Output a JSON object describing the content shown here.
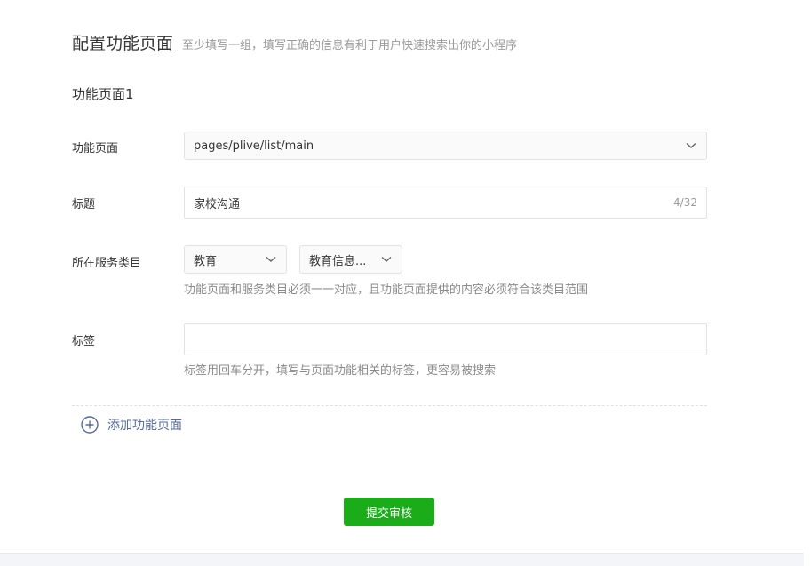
{
  "header": {
    "title": "配置功能页面",
    "subtitle": "至少填写一组，填写正确的信息有利于用户快速搜索出你的小程序"
  },
  "section": {
    "title": "功能页面1"
  },
  "form": {
    "page": {
      "label": "功能页面",
      "value": "pages/plive/list/main"
    },
    "title": {
      "label": "标题",
      "value": "家校沟通",
      "counter": "4/32"
    },
    "category": {
      "label": "所在服务类目",
      "primary": "教育",
      "secondary": "教育信息...",
      "hint": "功能页面和服务类目必须一一对应，且功能页面提供的内容必须符合该类目范围"
    },
    "tags": {
      "label": "标签",
      "value": "",
      "hint": "标签用回车分开，填写与页面功能相关的标签，更容易被搜索"
    }
  },
  "add_page": {
    "label": "添加功能页面",
    "icon": "plus-circle-icon"
  },
  "submit": {
    "label": "提交审核"
  },
  "colors": {
    "primary_green": "#1aad19",
    "link_blue": "#576b95"
  }
}
